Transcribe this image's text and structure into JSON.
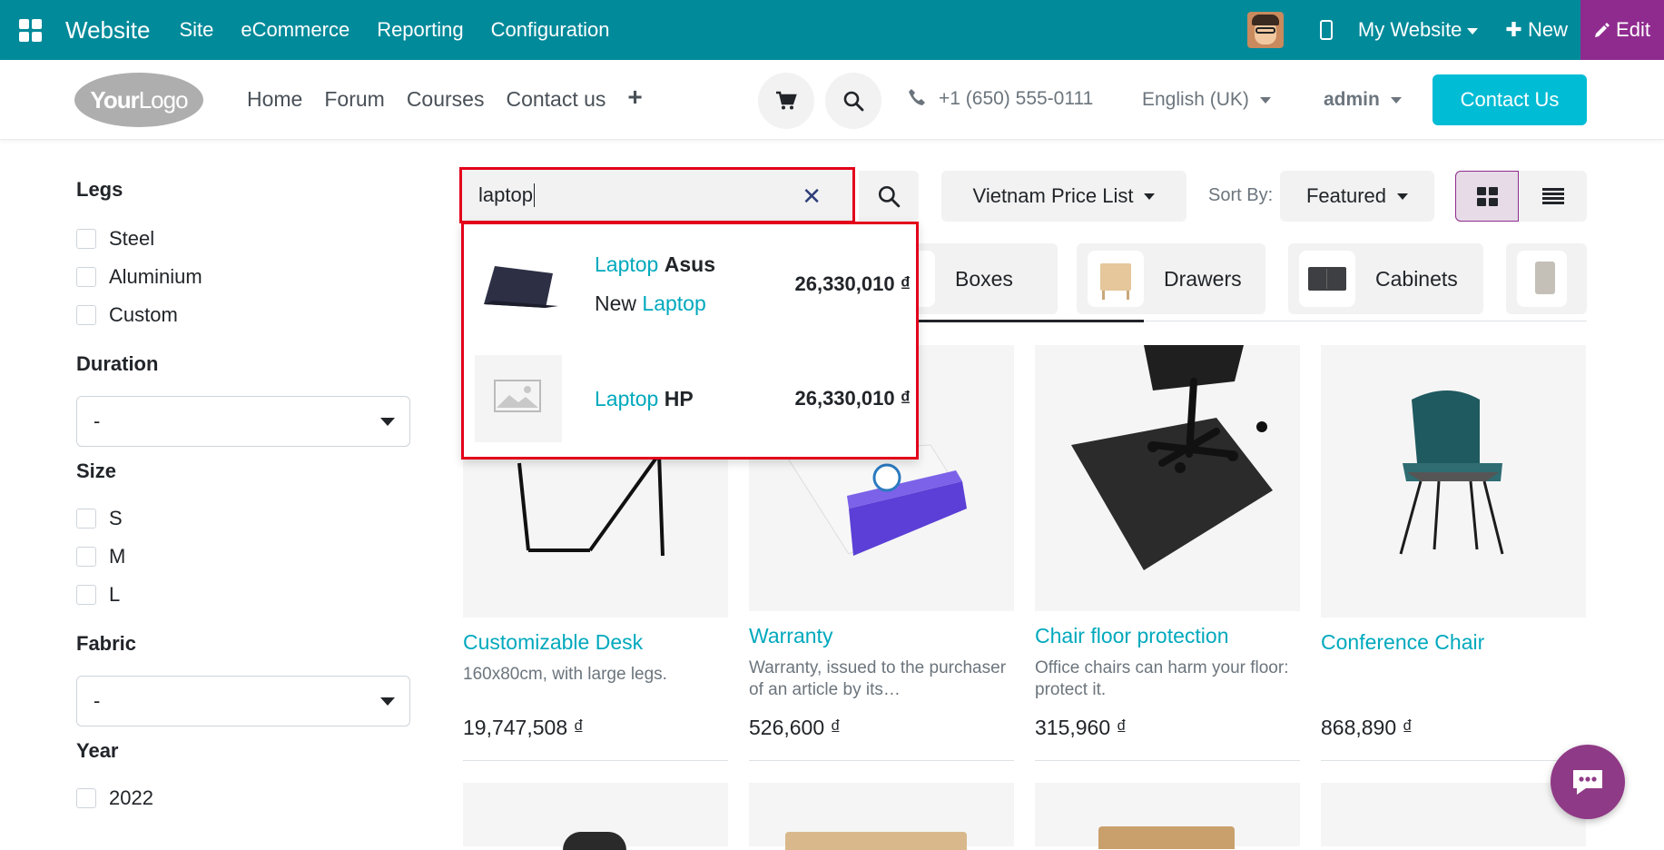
{
  "topbar": {
    "brand": "Website",
    "menus": [
      "Site",
      "eCommerce",
      "Reporting",
      "Configuration"
    ],
    "site_switcher": "My Website",
    "new_label": "New",
    "edit_label": "Edit",
    "accent": "#018a9a",
    "edit_color": "#8f2b8f"
  },
  "header": {
    "logo": {
      "bold": "Your",
      "light": "Logo"
    },
    "nav": [
      "Home",
      "Forum",
      "Courses",
      "Contact us"
    ],
    "phone": "+1 (650) 555-0111",
    "language": "English (UK)",
    "user": "admin",
    "contact_button": "Contact Us",
    "contact_color": "#00bcd4"
  },
  "filters": {
    "legs": {
      "title": "Legs",
      "options": [
        "Steel",
        "Aluminium",
        "Custom"
      ]
    },
    "duration": {
      "title": "Duration",
      "selected": "-"
    },
    "size": {
      "title": "Size",
      "options": [
        "S",
        "M",
        "L"
      ]
    },
    "fabric": {
      "title": "Fabric",
      "selected": "-"
    },
    "year": {
      "title": "Year",
      "options": [
        "2022"
      ]
    }
  },
  "search": {
    "value": "laptop",
    "pricelist": "Vietnam Price List",
    "sort_label": "Sort By:",
    "sort_value": "Featured",
    "suggestions": [
      {
        "highlight": "Laptop",
        "rest": "Asus",
        "sub_prefix": "New",
        "sub_highlight": "Laptop",
        "price": "26,330,010 ₫"
      },
      {
        "highlight": "Laptop",
        "rest": "HP",
        "price": "26,330,010 ₫"
      }
    ]
  },
  "categories": [
    "Boxes",
    "Drawers",
    "Cabinets"
  ],
  "products": [
    {
      "name": "Customizable Desk",
      "desc": "160x80cm, with large legs.",
      "price": "19,747,508 ₫"
    },
    {
      "name": "Warranty",
      "desc": "Warranty, issued to the purchaser of an article by its…",
      "price": "526,600 ₫"
    },
    {
      "name": "Chair floor protection",
      "desc": "Office chairs can harm your floor: protect it.",
      "price": "315,960 ₫"
    },
    {
      "name": "Conference Chair",
      "desc": "",
      "price": "868,890 ₫"
    }
  ],
  "icons": {
    "apps": "apps-grid-icon",
    "mobile": "mobile-preview-icon",
    "cart": "cart-icon",
    "search": "search-icon",
    "phone": "phone-icon",
    "clear": "close-icon",
    "grid_view": "grid-view-icon",
    "list_view": "list-view-icon",
    "chat": "chat-icon"
  }
}
